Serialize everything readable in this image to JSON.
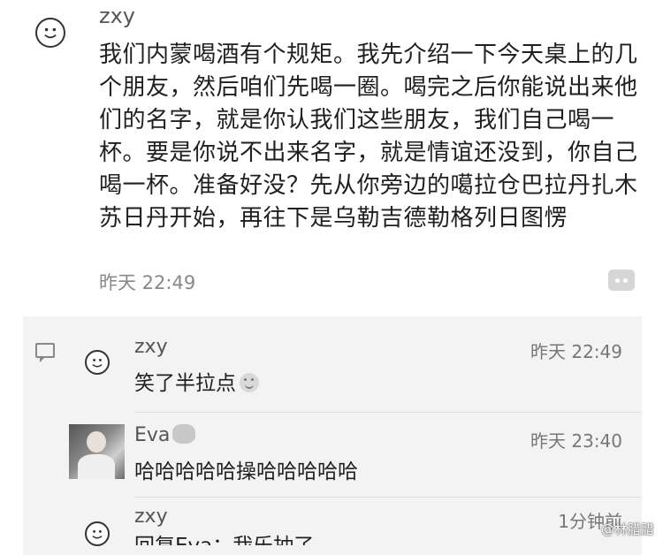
{
  "post": {
    "author": "zxy",
    "body": "我们内蒙喝酒有个规矩。我先介绍一下今天桌上的几个朋友，然后咱们先喝一圈。喝完之后你能说出来他们的名字，就是你认我们这些朋友，我们自己喝一杯。要是你说不出来名字，就是情谊还没到，你自己喝一杯。准备好没？先从你旁边的噶拉仓巴拉丹扎木苏日丹开始，再往下是乌勒吉德勒格列日图愣",
    "time": "昨天 22:49",
    "avatar_icon": "smiley-icon",
    "comment_button_icon": "more-icon"
  },
  "comments": [
    {
      "name": "zxy",
      "time": "昨天 22:49",
      "text": "笑了半拉点",
      "avatar_icon": "smiley-icon"
    },
    {
      "name": "Eva",
      "time": "昨天 23:40",
      "text": "哈哈哈哈哈操哈哈哈哈哈",
      "avatar_icon": "photo-avatar"
    },
    {
      "name": "zxy",
      "time": "1分钟前",
      "text": "回复Eva：我乐抽了",
      "avatar_icon": "smiley-icon"
    }
  ],
  "watermark": "@林腊腊"
}
